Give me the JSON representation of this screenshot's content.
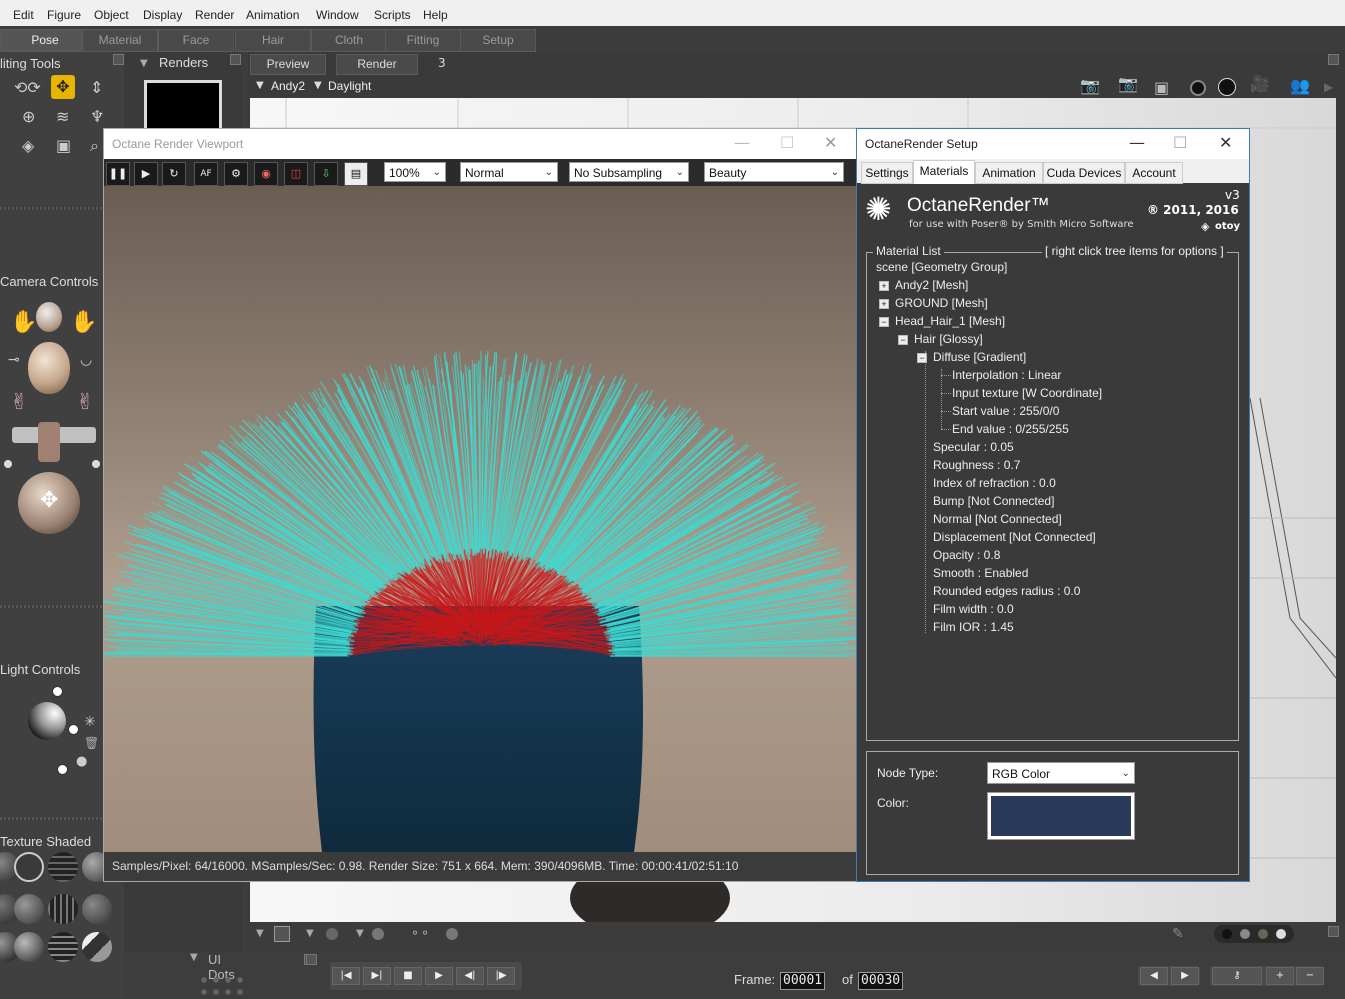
{
  "menubar": {
    "items": [
      "Edit",
      "Figure",
      "Object",
      "Display",
      "Render",
      "Animation",
      "Window",
      "Scripts",
      "Help"
    ]
  },
  "room_tabs": [
    "Pose",
    "Material",
    "Face",
    "Hair",
    "Cloth",
    "Fitting",
    "Setup"
  ],
  "active_room": "Pose",
  "left_panel": {
    "editing_tools_title": "liting Tools",
    "camera_controls_title": "Camera Controls",
    "light_controls_title": "Light Controls",
    "texture_shaded_title": "Texture Shaded"
  },
  "renders_panel": {
    "title": "Renders",
    "ui_dots_title": "UI Dots"
  },
  "document": {
    "tabs": [
      "Preview",
      "Render"
    ],
    "count": "3",
    "figure_selector": "Andy2",
    "light_selector": "Daylight"
  },
  "octane_viewport": {
    "title": "Octane Render Viewport",
    "zoom": "100%",
    "mode": "Normal",
    "subsampling": "No Subsampling",
    "pass": "Beauty",
    "status": "Samples/Pixel: 64/16000. MSamples/Sec: 0.98. Render Size: 751 x 664. Mem: 390/4096MB. Time: 00:00:41/02:51:10"
  },
  "octane_setup": {
    "title": "OctaneRender Setup",
    "tabs": [
      "Settings",
      "Materials",
      "Animation",
      "Cuda Devices",
      "Account"
    ],
    "active_tab": "Materials",
    "product_name": "OctaneRender™",
    "product_sub": "for use with Poser® by Smith Micro Software",
    "version": "v3",
    "copyright": "® 2011, 2016",
    "vendor": "otoy",
    "material_list_label": "Material List",
    "material_list_hint": "[ right click tree items for options ]",
    "tree": {
      "scene": "scene   [Geometry Group]",
      "andy": "Andy2   [Mesh]",
      "ground": "GROUND   [Mesh]",
      "head_hair": "Head_Hair_1   [Mesh]",
      "hair": "Hair   [Glossy]",
      "diffuse": "Diffuse   [Gradient]",
      "interpolation": "Interpolation  :  Linear",
      "input_texture": "Input texture   [W Coordinate]",
      "start_value": "Start value  :  255/0/0",
      "end_value": "End value  :  0/255/255",
      "specular": "Specular  :  0.05",
      "roughness": "Roughness  :  0.7",
      "ior": "Index of refraction  :  0.0",
      "bump": "Bump   [Not Connected]",
      "normal": "Normal   [Not Connected]",
      "displacement": "Displacement   [Not Connected]",
      "opacity": "Opacity  :  0.8",
      "smooth": "Smooth  :  Enabled",
      "rounded": "Rounded edges radius  :  0.0",
      "film_width": "Film width  :  0.0",
      "film_ior": "Film IOR  :  1.45"
    },
    "node_type_label": "Node Type:",
    "node_type_value": "RGB Color",
    "color_label": "Color:",
    "color_value": "#2a3a5a"
  },
  "animation": {
    "frame_label": "Frame:",
    "frame_value": "00001",
    "of_label": "of",
    "total_frames": "00030"
  },
  "colors": {
    "accent": "#e8b400",
    "hair_tip": "#3fd9d0",
    "hair_root": "#c8181a"
  }
}
